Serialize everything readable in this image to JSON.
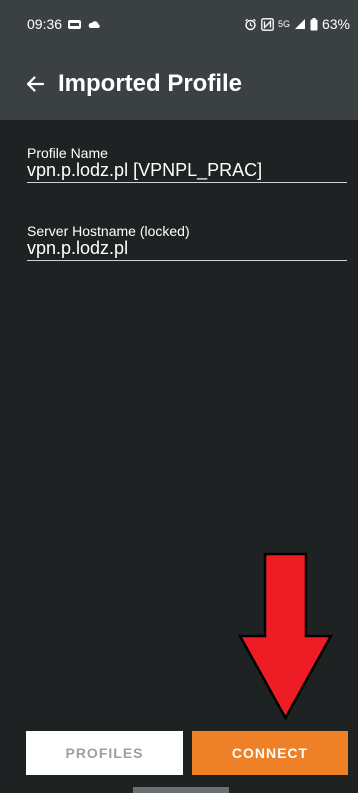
{
  "status_bar": {
    "time": "09:36",
    "battery": "63%",
    "network_type": "5G",
    "left_icons": [
      "message-icon",
      "cloud-icon"
    ],
    "right_icons": [
      "alarm-icon",
      "nfc-icon",
      "signal-icon",
      "battery-icon"
    ]
  },
  "app_bar": {
    "title": "Imported Profile",
    "back_icon": "back-arrow-icon"
  },
  "form": {
    "profile_name": {
      "label": "Profile Name",
      "value": "vpn.p.lodz.pl [VPNPL_PRAC]"
    },
    "server_hostname": {
      "label": "Server Hostname (locked)",
      "value": "vpn.p.lodz.pl"
    }
  },
  "annotation": {
    "arrow_color": "#ee1c24",
    "arrow_direction": "down"
  },
  "buttons": {
    "profiles_label": "PROFILES",
    "connect_label": "CONNECT"
  },
  "colors": {
    "bar_background": "#3b4043",
    "screen_background": "#1f2223",
    "accent": "#ee8127"
  }
}
